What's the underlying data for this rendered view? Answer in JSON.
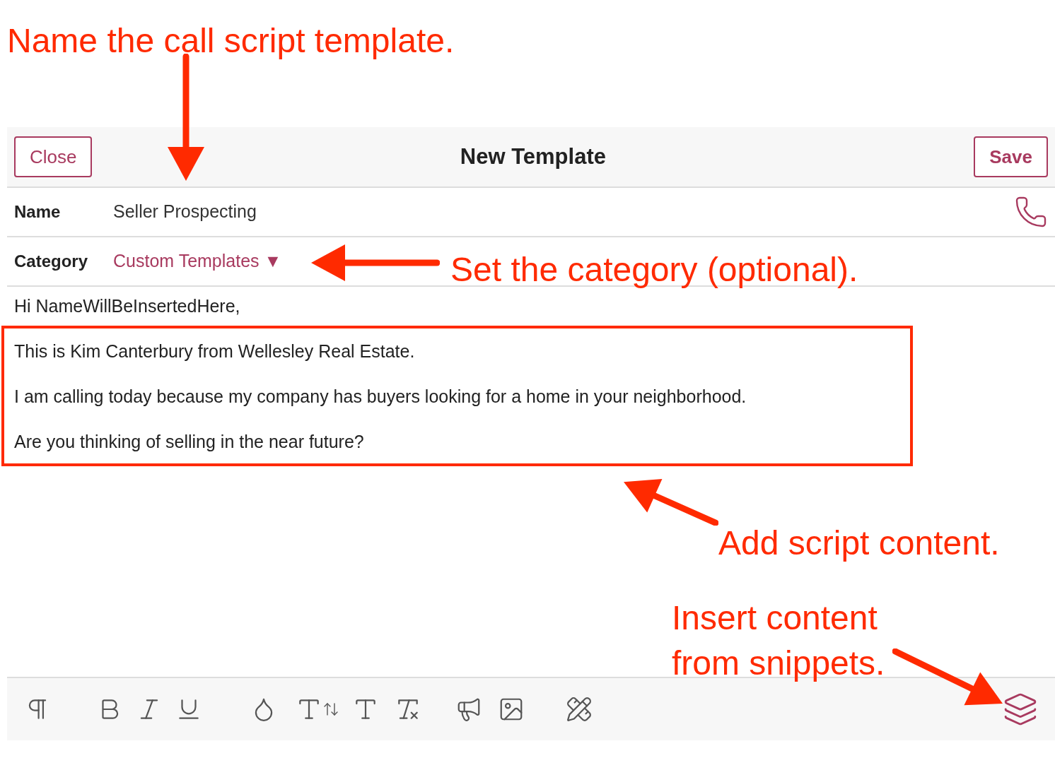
{
  "annotations": [
    {
      "text": "Name the call script template."
    },
    {
      "text": "Set the category (optional)."
    },
    {
      "text": "Add script content."
    },
    {
      "text": "Insert content from snippets."
    }
  ],
  "header": {
    "close": "Close",
    "title": "New Template",
    "save": "Save"
  },
  "name_field": {
    "label": "Name",
    "value": "Seller Prospecting"
  },
  "category_field": {
    "label": "Category",
    "value": "Custom Templates",
    "caret": "▼"
  },
  "body": [
    "Hi NameWillBeInsertedHere,",
    "This is Kim Canterbury from Wellesley Real Estate.",
    "I am calling today because my company has buyers looking for a home in your neighborhood.",
    "Are you thinking of selling in the near future?"
  ]
}
